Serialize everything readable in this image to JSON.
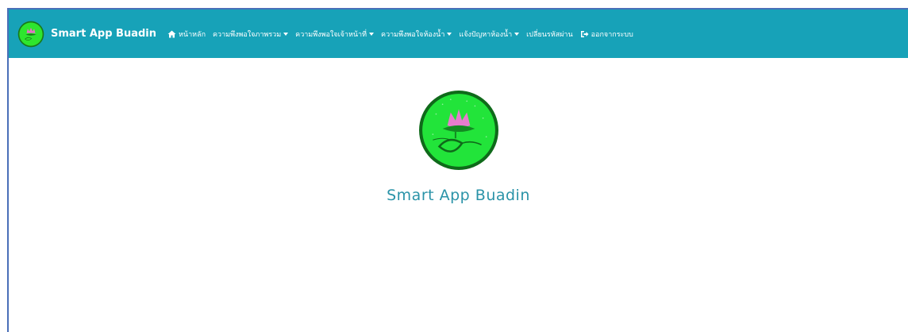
{
  "navbar": {
    "brand": "Smart App Buadin",
    "color": "#17a2b8",
    "items": [
      {
        "label": "หน้าหลัก",
        "icon": "home-icon",
        "dropdown": false
      },
      {
        "label": "ความพึงพอใจภาพรวม",
        "dropdown": true
      },
      {
        "label": "ความพึงพอใจเจ้าหน้าที่",
        "dropdown": true
      },
      {
        "label": "ความพึงพอใจห้องน้ำ",
        "dropdown": true
      },
      {
        "label": "แจ้งปัญหาห้องน้ำ",
        "dropdown": true
      },
      {
        "label": "เปลี่ยนรหัสผ่าน",
        "dropdown": false
      },
      {
        "label": "ออกจากระบบ",
        "icon": "logout-icon",
        "dropdown": false
      }
    ]
  },
  "hero": {
    "title": "Smart App Buadin",
    "title_color": "#2a93a8",
    "logo": "lotus-logo-icon"
  }
}
